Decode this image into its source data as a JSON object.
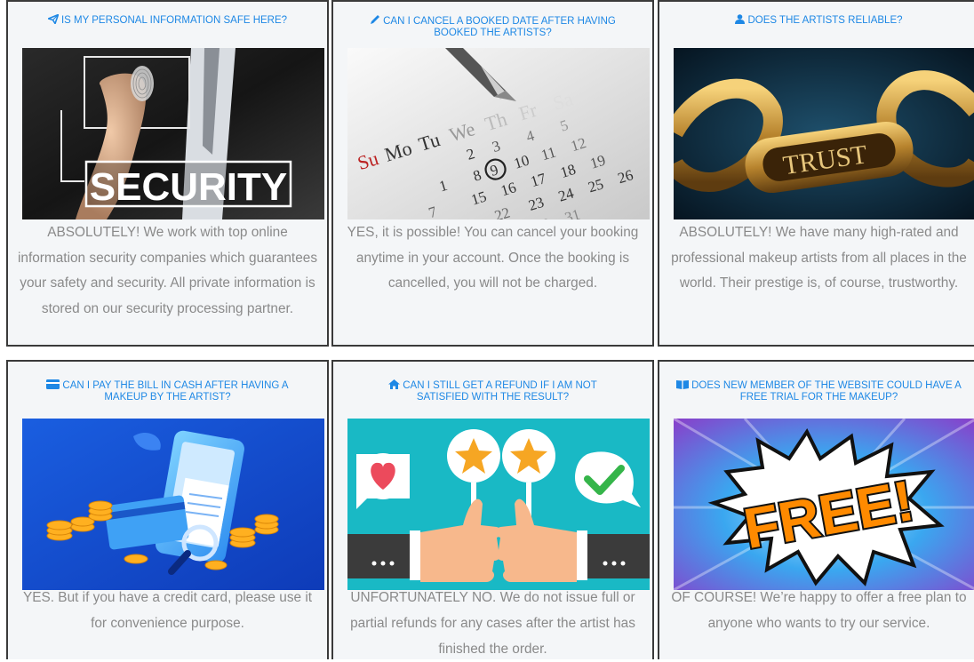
{
  "faq": [
    {
      "question": "IS MY PERSONAL INFORMATION SAFE HERE?",
      "icon": "paper-plane-icon",
      "image_text": "SECURITY",
      "answer": "ABSOLUTELY! We work with top online information security companies which guarantees your safety and security. All private information is stored on our security processing partner."
    },
    {
      "question": "CAN I CANCEL A BOOKED DATE AFTER HAVING BOOKED THE ARTISTS?",
      "icon": "pencil-icon",
      "image_text": "",
      "answer": "YES, it is possible! You can cancel your booking anytime in your account. Once the booking is cancelled, you will not be charged."
    },
    {
      "question": "DOES THE ARTISTS RELIABLE?",
      "icon": "user-icon",
      "image_text": "TRUST",
      "answer": "ABSOLUTELY! We have many high-rated and professional makeup artists from all places in the world. Their prestige is, of course, trustworthy."
    },
    {
      "question": "CAN I PAY THE BILL IN CASH AFTER HAVING A MAKEUP BY THE ARTIST?",
      "icon": "credit-card-icon",
      "image_text": "",
      "answer": "YES. But if you have a credit card, please use it for convenience purpose."
    },
    {
      "question": "CAN I STILL GET A REFUND IF I AM NOT SATISFIED WITH THE RESULT?",
      "icon": "home-icon",
      "image_text": "",
      "answer": "UNFORTUNATELY NO. We do not issue full or partial refunds for any cases after the artist has finished the order."
    },
    {
      "question": "DOES NEW MEMBER OF THE WEBSITE COULD HAVE A FREE TRIAL FOR THE MAKEUP?",
      "icon": "book-icon",
      "image_text": "FREE!",
      "answer": "OF COURSE! We’re happy to offer a free plan to anyone who wants to try our service."
    }
  ],
  "colors": {
    "question": "#1e88e5",
    "answer": "#8a8a8a",
    "card_bg": "#f4f6f8",
    "border": "#3a3a3a"
  }
}
